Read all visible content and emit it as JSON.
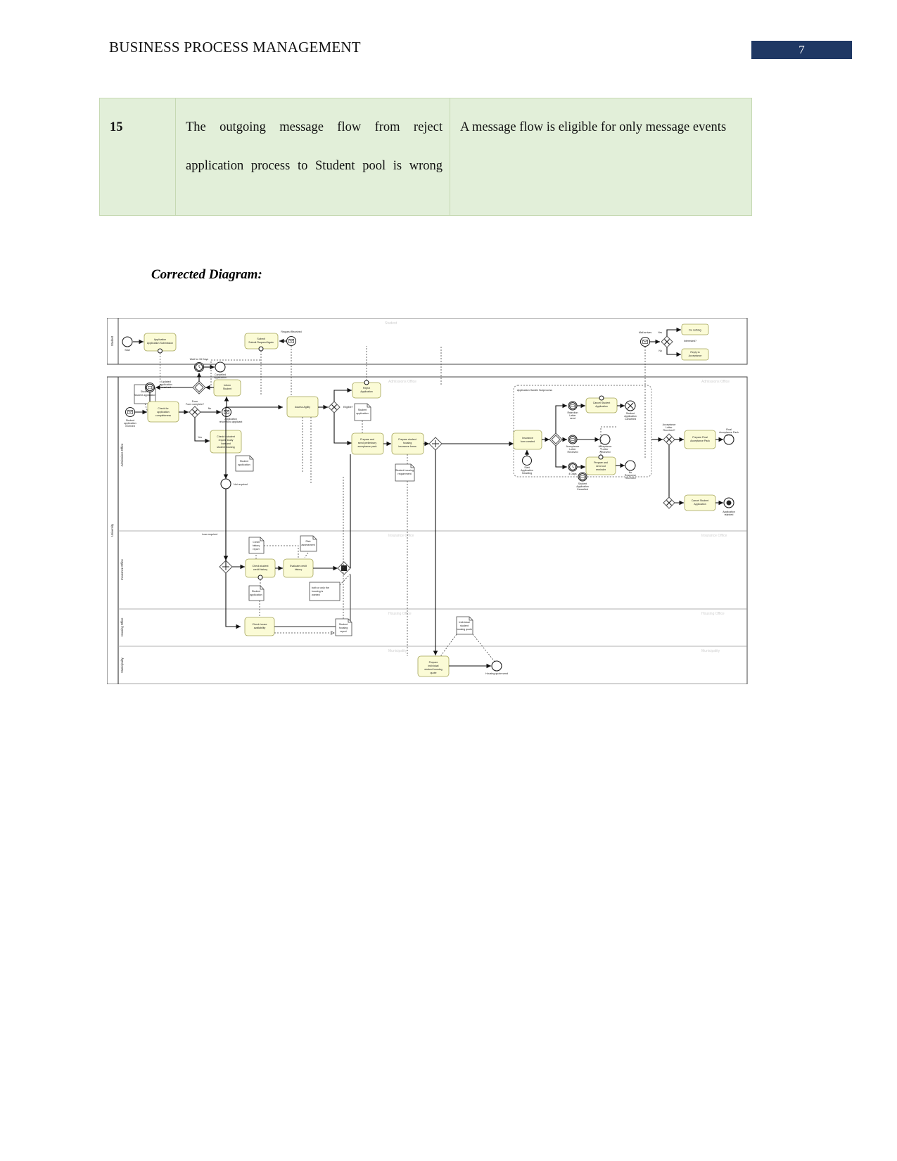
{
  "header": {
    "title": "BUSINESS PROCESS MANAGEMENT",
    "page_number": "7",
    "badge_color": "#1f3864"
  },
  "table": {
    "row_number": "15",
    "issue": "The outgoing message flow from reject application process to Student pool is wrong",
    "reason": "A message flow is eligible for only message events",
    "fill_color": "#e2efd9",
    "border_color": "#c6d9b3"
  },
  "section": {
    "caption": "Corrected Diagram:"
  },
  "diagram": {
    "type": "bpmn",
    "task_fill": "#fbfbd6",
    "task_stroke": "#a5a55a",
    "pools": [
      {
        "name": "Student",
        "header": "Student"
      },
      {
        "name": "University",
        "header": "University"
      }
    ],
    "lanes": [
      {
        "label": "Admissions Office",
        "watermark": "Admissions Office"
      },
      {
        "label": "Insurance Office",
        "watermark": "Insurance Office"
      },
      {
        "label": "Housing Office",
        "watermark": "Housing Office"
      },
      {
        "label": "Municipality",
        "watermark": "Municipality"
      }
    ],
    "student_lane": {
      "label": "Student",
      "watermark": "Student",
      "elements": [
        {
          "kind": "start-event",
          "label": "Start"
        },
        {
          "kind": "task",
          "label": "Application Submission"
        },
        {
          "kind": "task",
          "label": "Submit Request Again"
        },
        {
          "kind": "message-event",
          "label": "Request Received"
        },
        {
          "kind": "message-event",
          "label": "Mail arrives"
        },
        {
          "kind": "gateway-xor",
          "label": "Interested?"
        },
        {
          "kind": "task",
          "label": "Do nothing"
        },
        {
          "kind": "task",
          "label": "Reply to Acceptance"
        },
        {
          "kind": "flow-label",
          "label": "Yes"
        },
        {
          "kind": "flow-label",
          "label": "No"
        }
      ]
    },
    "admissions_lane": {
      "label": "Admissions Office",
      "elements": [
        {
          "kind": "message-start-event",
          "label": "Student application received"
        },
        {
          "kind": "data-object",
          "label": "Student application"
        },
        {
          "kind": "task",
          "label": "Check for application completeness"
        },
        {
          "kind": "gateway-xor",
          "label": "Form complete?"
        },
        {
          "kind": "flow-label",
          "label": "No"
        },
        {
          "kind": "flow-label",
          "label": "Yes"
        },
        {
          "kind": "message-throw-event",
          "label": "Application returned to applicant"
        },
        {
          "kind": "task",
          "label": "Inform Student"
        },
        {
          "kind": "gateway-event",
          "label": ""
        },
        {
          "kind": "timer-event",
          "label": "Wait for 15 Days"
        },
        {
          "kind": "end-event",
          "label": "Cancelled Application"
        },
        {
          "kind": "message-catch-event",
          "label": "Updated application received"
        },
        {
          "kind": "task",
          "label": "Check if student require study loan and student housing"
        },
        {
          "kind": "data-object",
          "label": "Student application"
        },
        {
          "kind": "task",
          "label": "Assess Agility"
        },
        {
          "kind": "gateway-xor",
          "label": "Eligible?"
        },
        {
          "kind": "task",
          "label": "Reject Application"
        },
        {
          "kind": "data-object",
          "label": "Student application"
        },
        {
          "kind": "task",
          "label": "Prepare and send preliminary acceptance pack"
        },
        {
          "kind": "task",
          "label": "Prepare student housing insurance forms"
        },
        {
          "kind": "data-object",
          "label": "Student housing requirement"
        },
        {
          "kind": "gateway-parallel",
          "label": ""
        },
        {
          "kind": "gateway-xor",
          "label": "Acceptance Letter Received?"
        },
        {
          "kind": "task",
          "label": "Prepare Final Acceptance Pack"
        },
        {
          "kind": "end-event",
          "label": "Final Acceptance Pack send"
        },
        {
          "kind": "gateway-xor",
          "label": ""
        },
        {
          "kind": "task",
          "label": "Cancel Student Application"
        },
        {
          "kind": "end-event",
          "label": "Application rejected"
        }
      ]
    },
    "subprocess": {
      "label": "Application Handle Subprocess",
      "elements": [
        {
          "kind": "start-event",
          "label": "Start Application Handling"
        },
        {
          "kind": "task",
          "label": "Insurance form created"
        },
        {
          "kind": "gateway-event",
          "label": ""
        },
        {
          "kind": "message-event",
          "label": "Rejection Letter send"
        },
        {
          "kind": "task",
          "label": "Cancel Student Application"
        },
        {
          "kind": "end-event-terminate",
          "label": "Student Application Cancelled"
        },
        {
          "kind": "message-event",
          "label": "Acceptance Letter Received"
        },
        {
          "kind": "end-event",
          "label": "Acceptance Letter Received"
        },
        {
          "kind": "timer-event",
          "label": "4 Days"
        },
        {
          "kind": "task",
          "label": "Prepare and send out reminder"
        },
        {
          "kind": "end-event",
          "label": "No Response Received"
        },
        {
          "kind": "boundary-event",
          "label": "Student Application Cancelled"
        }
      ]
    },
    "insurance_lane": {
      "label": "Insurance Office",
      "elements": [
        {
          "kind": "flow-label",
          "label": "Loan required"
        },
        {
          "kind": "gateway-parallel",
          "label": ""
        },
        {
          "kind": "data-object",
          "label": "Credit history report"
        },
        {
          "kind": "task",
          "label": "Check student credit history"
        },
        {
          "kind": "task",
          "label": "Evaluate credit history"
        },
        {
          "kind": "data-object",
          "label": "Risk assessment"
        },
        {
          "kind": "gateway-parallel-end",
          "label": ""
        },
        {
          "kind": "data-object",
          "label": "Student application"
        },
        {
          "kind": "annotation",
          "label": "both or only the housing is wanted"
        }
      ]
    },
    "housing_lane": {
      "label": "Housing Office",
      "elements": [
        {
          "kind": "task",
          "label": "Check house availability"
        },
        {
          "kind": "data-object",
          "label": "Student housing report"
        },
        {
          "kind": "data-object",
          "label": "Individual student housing quote"
        }
      ]
    },
    "municipality_lane": {
      "label": "Municipality",
      "elements": [
        {
          "kind": "task",
          "label": "Prepare individual student housing quote"
        },
        {
          "kind": "end-event",
          "label": "Housing quote send"
        }
      ]
    }
  }
}
